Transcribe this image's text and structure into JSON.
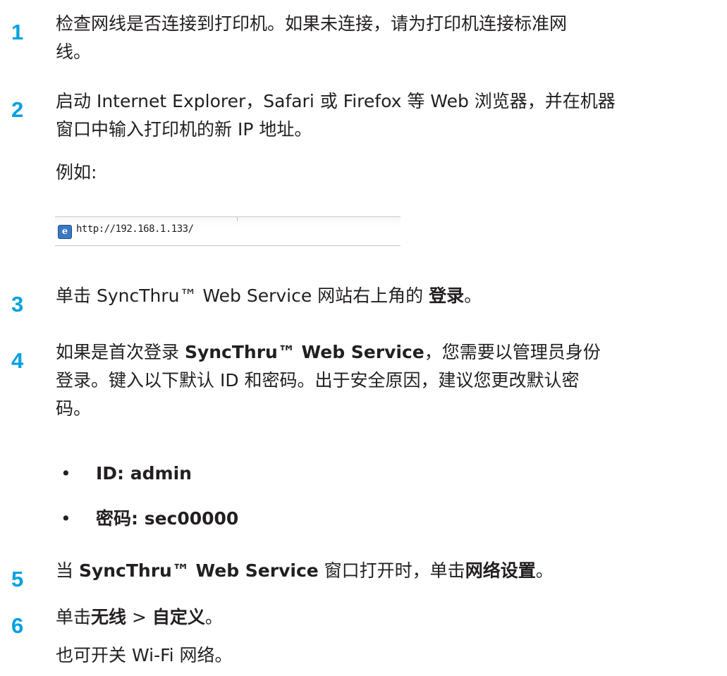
{
  "steps": [
    {
      "num": "1",
      "lines": [
        "检查网线是否连接到打印机。如果未连接，请为打印机连接标准网",
        "线。"
      ]
    },
    {
      "num": "2",
      "lines": [
        "启动 Internet Explorer，Safari 或 Firefox 等 Web 浏览器，并在机器",
        "窗口中输入打印机的新 IP 地址。"
      ],
      "example_label": "例如:"
    },
    {
      "num": "3",
      "prefix": "单击 SyncThru™ Web Service 网站右上角的 ",
      "bold": "登录",
      "suffix": "。"
    },
    {
      "num": "4",
      "line1_prefix": "如果是首次登录 ",
      "line1_bold": "SyncThru™ Web Service",
      "line1_suffix": "，您需要以管理员身份",
      "line2": "登录。键入以下默认 ID 和密码。出于安全原因，建议您更改默认密",
      "line3": "码。"
    },
    {
      "num": "5",
      "prefix": "当 ",
      "bold1": "SyncThru™ Web Service",
      "middle": " 窗口打开时，单击",
      "bold2": "网络设置",
      "suffix": "。"
    },
    {
      "num": "6",
      "prefix": "单击",
      "bold1": "无线",
      "sep": " > ",
      "bold2": "自定义",
      "suffix": "。",
      "note": "也可开关 Wi-Fi 网络。"
    }
  ],
  "bullets": [
    {
      "dot": "•",
      "text": "ID: admin"
    },
    {
      "dot": "•",
      "text": "密码: sec00000"
    }
  ],
  "example_url": "http://192.168.1.133/",
  "icons": {
    "browser": "internet-explorer-icon"
  },
  "colors": {
    "step_number": "#00a1df",
    "text": "#231f20"
  }
}
